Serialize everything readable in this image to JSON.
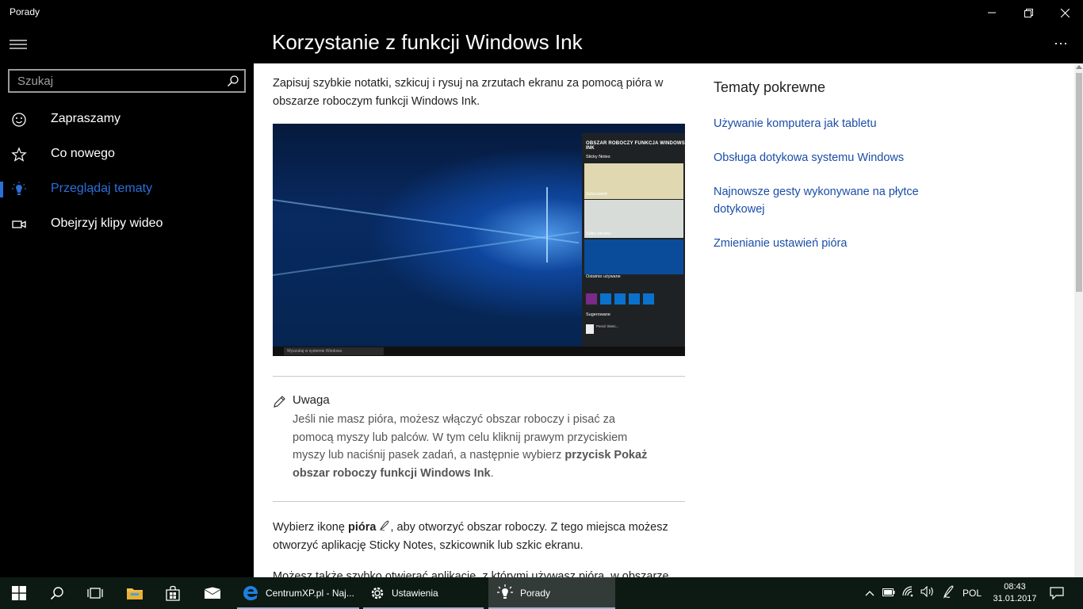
{
  "window": {
    "title": "Porady"
  },
  "search": {
    "placeholder": "Szukaj"
  },
  "nav": {
    "items": [
      {
        "label": "Zapraszamy",
        "icon": "smiley-icon",
        "active": false
      },
      {
        "label": "Co nowego",
        "icon": "star-icon",
        "active": false
      },
      {
        "label": "Przeglądaj tematy",
        "icon": "lightbulb-icon",
        "active": true
      },
      {
        "label": "Obejrzyj klipy wideo",
        "icon": "video-icon",
        "active": false
      }
    ]
  },
  "header": {
    "title": "Korzystanie z funkcji Windows Ink",
    "more_label": "···"
  },
  "article": {
    "intro": "Zapisuj szybkie notatki, szkicuj i rysuj na zrzutach ekranu za pomocą pióra w obszarze roboczym funkcji Windows Ink.",
    "image": {
      "panel_title": "OBSZAR ROBOCZY FUNKCJA WINDOWS INK",
      "sticky_notes": "Sticky Notes",
      "sketchpad": "Szkicownik",
      "screen_sketch": "Szkic ekranu",
      "recent": "Ostatnio używane",
      "suggested": "Sugerowane",
      "suggested_app": "Pencil Sketc...",
      "taskbar_search": "Wyszukaj w systemie Windows"
    },
    "note": {
      "title": "Uwaga",
      "body_1": "Jeśli nie masz pióra, możesz włączyć obszar roboczy i pisać za pomocą myszy lub palców. W tym celu kliknij prawym przyciskiem myszy lub naciśnij pasek zadań, a następnie wybierz ",
      "body_bold": "przycisk Pokaż obszar roboczy funkcji Windows Ink",
      "body_2": "."
    },
    "para2_a": "Wybierz ikonę ",
    "para2_bold": "pióra",
    "para2_b": ", aby otworzyć obszar roboczy. Z tego miejsca możesz otworzyć aplikację Sticky Notes, szkicownik lub szkic ekranu.",
    "para3": "Możesz także szybko otwierać aplikacje, z którymi używasz pióra, w obszarze roboczym funkcji Windows Ink."
  },
  "related": {
    "title": "Tematy pokrewne",
    "links": [
      "Używanie komputera jak tabletu",
      "Obsługa dotykowa systemu Windows",
      "Najnowsze gesty wykonywane na płytce dotykowej",
      "Zmienianie ustawień pióra"
    ]
  },
  "taskbar": {
    "apps": [
      {
        "label": "CentrumXP.pl - Naj...",
        "icon": "edge-icon"
      },
      {
        "label": "Ustawienia",
        "icon": "settings-gear-icon"
      },
      {
        "label": "Porady",
        "icon": "tips-lightbulb-icon"
      }
    ],
    "language": "POL",
    "time": "08:43",
    "date": "31.01.2017"
  },
  "colors": {
    "accent": "#2b6fd8",
    "link": "#1a4ea8"
  }
}
